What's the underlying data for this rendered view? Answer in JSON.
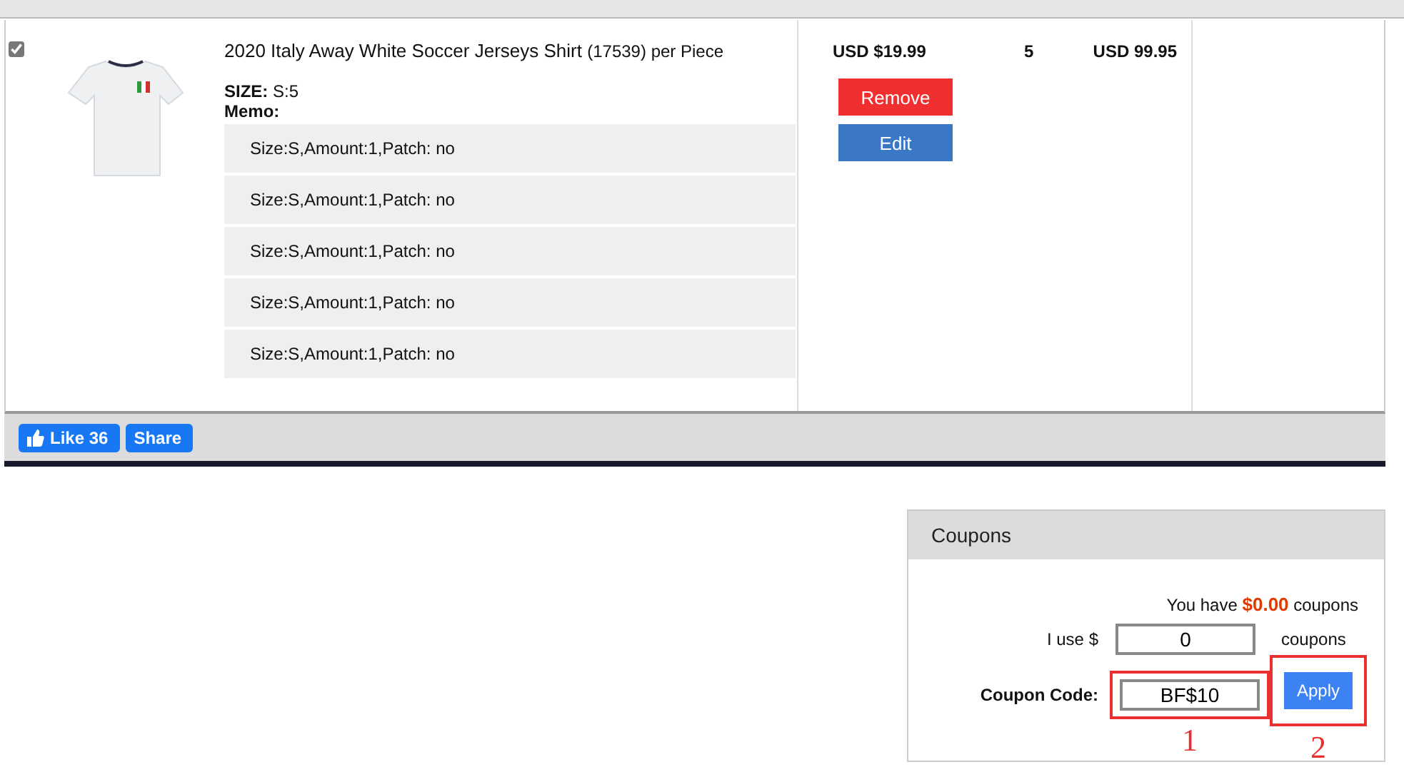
{
  "cart_item": {
    "checked": true,
    "title": "2020 Italy Away White Soccer Jerseys Shirt",
    "code": "(17539)",
    "unit": "per Piece",
    "size_label": "SIZE:",
    "size_value": "S:5",
    "memo_label": "Memo:",
    "memo_lines": [
      "Size:S,Amount:1,Patch: no",
      "Size:S,Amount:1,Patch: no",
      "Size:S,Amount:1,Patch: no",
      "Size:S,Amount:1,Patch: no",
      "Size:S,Amount:1,Patch: no"
    ],
    "price": "USD $19.99",
    "quantity": "5",
    "total": "USD 99.95",
    "buttons": [
      {
        "label": "Remove",
        "kind": "remove"
      },
      {
        "label": "Edit",
        "kind": "edit"
      }
    ]
  },
  "social": {
    "like": "Like 36",
    "share": "Share"
  },
  "coupons": {
    "title": "Coupons",
    "balance": "You have **$0.00** coupons",
    "use_label": "I use $",
    "use_value": "0",
    "use_suffix": "coupons",
    "code_label": "Coupon Code:",
    "code_value": "BF$10",
    "apply": "Apply"
  },
  "annotations": [
    {
      "label": "1"
    },
    {
      "label": "2"
    }
  ]
}
